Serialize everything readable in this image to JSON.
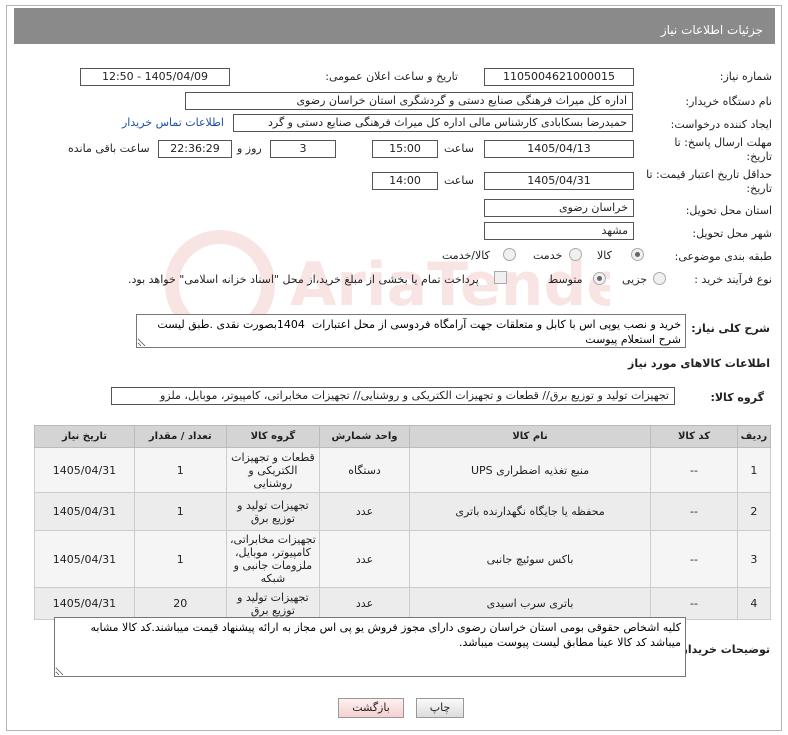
{
  "header": {
    "title": "جزئیات اطلاعات نیاز"
  },
  "need_number": {
    "label": "شماره نیاز:",
    "value": "1105004621000015"
  },
  "announce_date": {
    "label": "تاریخ و ساعت اعلان عمومی:",
    "value": "1405/04/09 - 12:50"
  },
  "buyer_org": {
    "label": "نام دستگاه خریدار:",
    "value": "اداره کل میراث فرهنگی  صنایع دستی و گردشگری استان خراسان رضوی"
  },
  "requester": {
    "label": "ایجاد کننده درخواست:",
    "value": "حمیدرضا بسکابادی کارشناس مالی اداره کل میراث فرهنگی  صنایع دستی و گرد",
    "contact_link": "اطلاعات تماس خریدار"
  },
  "reply_deadline": {
    "label": "مهلت ارسال پاسخ: تا تاریخ:",
    "date": "1405/04/13",
    "time_label": "ساعت",
    "time": "15:00",
    "days": "3",
    "days_label": "روز و",
    "remaining": "22:36:29",
    "remaining_label": "ساعت باقی مانده"
  },
  "price_validity": {
    "label": "حداقل تاریخ اعتبار قیمت: تا تاریخ:",
    "date": "1405/04/31",
    "time_label": "ساعت",
    "time": "14:00"
  },
  "province": {
    "label": "استان محل تحویل:",
    "value": "خراسان رضوی"
  },
  "city": {
    "label": "شهر محل تحویل:",
    "value": "مشهد"
  },
  "category": {
    "label": "طبقه بندی موضوعی:",
    "options": [
      "کالا",
      "خدمت",
      "کالا/خدمت"
    ],
    "selected": "کالا"
  },
  "purchase_type": {
    "label": "نوع فرآیند خرید :",
    "options": [
      "جزیی",
      "متوسط"
    ],
    "selected": "متوسط",
    "payment_note": "پرداخت تمام یا بخشی از مبلغ خرید،از محل \"اسناد خزانه اسلامی\" خواهد بود."
  },
  "description": {
    "label": "شرح کلی نیاز:",
    "value": "خرید و نصب یوپی اس با کابل و متعلقات جهت آرامگاه فردوسی از محل اعتبارات  1404بصورت نقدی .طبق لیست شرح استعلام پیوست"
  },
  "goods_section": {
    "title": "اطلاعات کالاهای مورد نیاز"
  },
  "goods_group": {
    "label": "گروه کالا:",
    "value": "تجهیزات تولید و توزیع برق// قطعات و تجهیزات الکتریکی و روشنایی// تجهیزات مخابراتی، کامپیوتر، موبایل، ملزو"
  },
  "table": {
    "headers": [
      "ردیف",
      "کد کالا",
      "نام کالا",
      "واحد شمارش",
      "گروه کالا",
      "تعداد / مقدار",
      "تاریخ نیاز"
    ],
    "rows": [
      [
        "1",
        "--",
        "منبع تغذیه اضطراری UPS",
        "دستگاه",
        "قطعات و تجهیزات الکتریکی و روشنایی",
        "1",
        "1405/04/31"
      ],
      [
        "2",
        "--",
        "محفظه یا جایگاه نگهدارنده باتری",
        "عدد",
        "تجهیزات تولید و توزیع برق",
        "1",
        "1405/04/31"
      ],
      [
        "3",
        "--",
        "باکس سوئیچ جانبی",
        "عدد",
        "تجهیزات مخابراتی، کامپیوتر، موبایل، ملزومات جانبی و شبکه",
        "1",
        "1405/04/31"
      ],
      [
        "4",
        "--",
        "باتری سرب اسیدی",
        "عدد",
        "تجهیزات تولید و توزیع برق",
        "20",
        "1405/04/31"
      ]
    ]
  },
  "buyer_notes": {
    "label": "توضیحات خریدار:",
    "value": "کلیه اشخاص حقوقی بومی استان خراسان رضوی دارای مجوز فروش یو پی اس مجاز به ارائه پیشنهاد قیمت میباشند.کد کالا مشابه میباشد کد کالا عینا مطابق لیست پیوست میباشد."
  },
  "buttons": {
    "print": "چاپ",
    "back": "بازگشت"
  },
  "watermark": {
    "text": "AriaTender.net"
  }
}
